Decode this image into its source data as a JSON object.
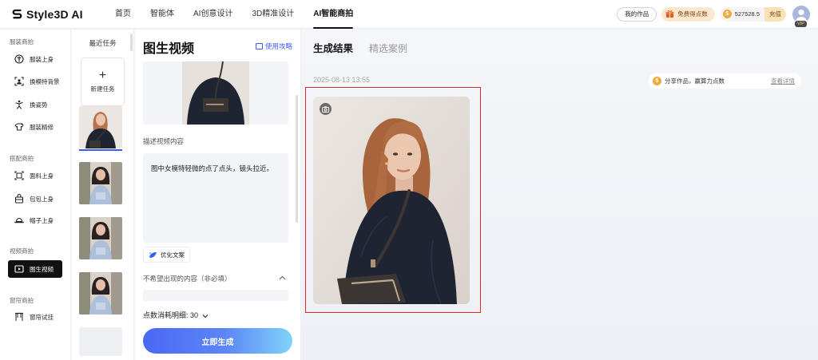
{
  "app": {
    "name": "Style3D AI"
  },
  "nav": [
    {
      "label": "首页",
      "active": false
    },
    {
      "label": "智能体",
      "active": false
    },
    {
      "label": "AI创意设计",
      "active": false
    },
    {
      "label": "3D精准设计",
      "active": false
    },
    {
      "label": "AI智能商拍",
      "active": true
    }
  ],
  "topbar": {
    "my_works": "我的作品",
    "free_points": "免费得点数",
    "balance": "527528.5",
    "recharge": "充值",
    "vip": "VIP"
  },
  "sidebar": {
    "sections": [
      {
        "title": "服装商拍",
        "items": [
          {
            "label": "服装上身",
            "icon": "hanger-icon"
          },
          {
            "label": "换模特背景",
            "icon": "background-swap-icon"
          },
          {
            "label": "换姿势",
            "icon": "pose-icon"
          },
          {
            "label": "服装精修",
            "icon": "retouch-icon"
          }
        ]
      },
      {
        "title": "搭配商拍",
        "items": [
          {
            "label": "面料上身",
            "icon": "fabric-icon"
          },
          {
            "label": "包包上身",
            "icon": "bag-icon"
          },
          {
            "label": "帽子上身",
            "icon": "hat-icon"
          }
        ]
      },
      {
        "title": "视频商拍",
        "items": [
          {
            "label": "图生视频",
            "icon": "video-icon",
            "active": true
          }
        ]
      },
      {
        "title": "窗帘商拍",
        "items": [
          {
            "label": "窗帘试挂",
            "icon": "curtain-icon"
          }
        ]
      }
    ]
  },
  "tasks": {
    "title": "最近任务",
    "new_task": "新建任务",
    "new_task_icon": "plus-icon"
  },
  "form": {
    "title": "图生视频",
    "guide": "使用攻略",
    "desc_label": "描述视频内容",
    "desc_text": "图中女模特轻微的点了点头，镜头拉近。",
    "optimize": "优化文案",
    "negative_label": "不希望出现的内容（非必填）",
    "cost_label": "点数消耗明细: 30",
    "generate": "立即生成"
  },
  "results": {
    "tabs": [
      {
        "label": "生成结果",
        "active": true
      },
      {
        "label": "精选案例",
        "active": false
      }
    ],
    "timestamp": "2025-08-13 13:55",
    "share_text": "分享作品，赢算力点数",
    "share_detail": "查看详情"
  },
  "colors": {
    "accent": "#3a5cf6",
    "highlight_frame": "#e12b2b",
    "garment": "#1f2433",
    "bag": "#3b3633"
  }
}
